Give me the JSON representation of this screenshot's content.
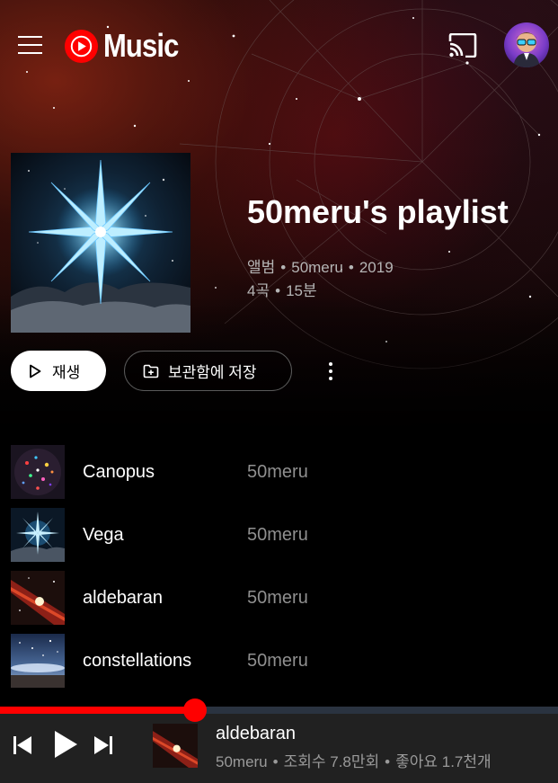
{
  "app": {
    "logo_text": "Music"
  },
  "header": {
    "avatar_alt": "user avatar"
  },
  "album": {
    "title": "50meru's playlist",
    "type": "앨범",
    "artist": "50meru",
    "year": "2019",
    "track_count": "4곡",
    "duration": "15분"
  },
  "actions": {
    "play_label": "재생",
    "save_label": "보관함에 저장"
  },
  "tracks": [
    {
      "title": "Canopus",
      "artist": "50meru"
    },
    {
      "title": "Vega",
      "artist": "50meru"
    },
    {
      "title": "aldebaran",
      "artist": "50meru"
    },
    {
      "title": "constellations",
      "artist": "50meru"
    }
  ],
  "player": {
    "title": "aldebaran",
    "artist": "50meru",
    "views": "조회수 7.8만회",
    "likes": "좋아요 1.7천개",
    "progress": 0.35
  },
  "colors": {
    "accent": "#ff0000",
    "background": "#000000",
    "player_bg": "#212121"
  }
}
